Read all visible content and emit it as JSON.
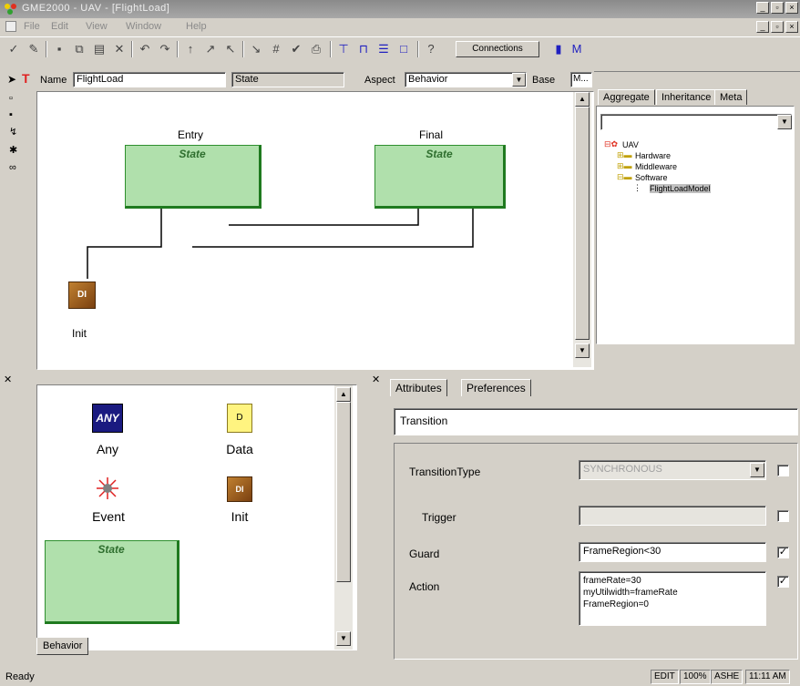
{
  "window": {
    "title": "GME2000 - UAV - [FlightLoad]"
  },
  "menu": [
    "File",
    "Edit",
    "View",
    "Window",
    "Help"
  ],
  "toolbar": {
    "connections_label": "Connections"
  },
  "namebar": {
    "name_label": "Name",
    "name_value": "FlightLoad",
    "kind_value": "State",
    "aspect_label": "Aspect",
    "aspect_value": "Behavior",
    "base_label": "Base",
    "base_value": "M..."
  },
  "diagram": {
    "states": [
      {
        "label": "Entry",
        "type": "State"
      },
      {
        "label": "Final",
        "type": "State"
      }
    ],
    "init_label": "Init"
  },
  "browser": {
    "tabs": [
      "Aggregate",
      "Inheritance",
      "Meta"
    ],
    "tree": [
      {
        "label": "UAV",
        "level": 0
      },
      {
        "label": "Hardware",
        "level": 1
      },
      {
        "label": "Middleware",
        "level": 1
      },
      {
        "label": "Software",
        "level": 1
      },
      {
        "label": "FlightLoadModel",
        "level": 2
      }
    ]
  },
  "partbrowser": {
    "items": [
      {
        "label": "Any",
        "icon": "any-icon"
      },
      {
        "label": "Data",
        "icon": "data-icon"
      },
      {
        "label": "Event",
        "icon": "event-icon"
      },
      {
        "label": "Init",
        "icon": "init-icon"
      }
    ],
    "state_label": "State",
    "tab": "Behavior"
  },
  "attributes": {
    "tabs": [
      "Attributes",
      "Preferences"
    ],
    "object_name": "Transition",
    "rows": [
      {
        "label": "TransitionType",
        "value": "SYNCHRONOUS",
        "kind": "select",
        "checked": false
      },
      {
        "label": "Trigger",
        "value": "",
        "kind": "text",
        "checked": false
      },
      {
        "label": "Guard",
        "value": "FrameRegion<30",
        "kind": "text",
        "checked": true
      },
      {
        "label": "Action",
        "value": "frameRate=30\nmyUtilwidth=frameRate\nFrameRegion=0",
        "kind": "multiline",
        "checked": true
      }
    ]
  },
  "statusbar": {
    "text": "Ready",
    "cells": [
      "EDIT",
      "100%",
      "ASHE",
      "11:11 AM"
    ]
  }
}
